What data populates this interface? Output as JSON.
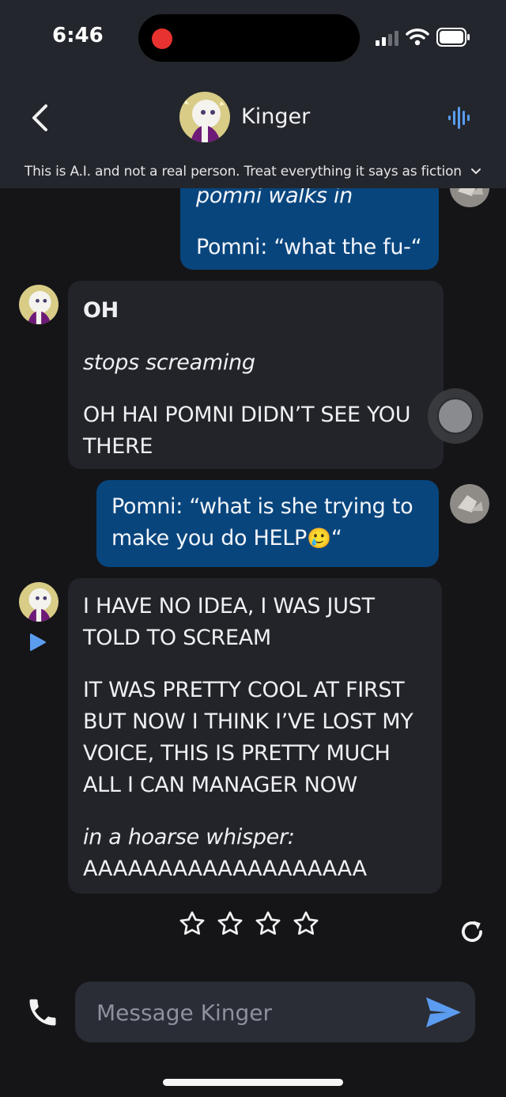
{
  "status_bar": {
    "time": "6:46"
  },
  "header": {
    "title": "Kinger",
    "disclaimer": "This is A.I. and not a real person. Treat everything it says as fiction"
  },
  "messages": {
    "m1": {
      "line1": "pomni walks in",
      "line2": "Pomni: “what the fu-“"
    },
    "m2": {
      "line1": "OH",
      "line2": "stops screaming",
      "line3a": "OH HAI POMNI DIDN’T SEE YOU",
      "line3b": "THERE"
    },
    "m3": {
      "line1": "Pomni: “what is she trying to",
      "line2": "make you do HELP",
      "emoji": "🥲",
      "end": "“"
    },
    "m4": {
      "p1a": "I HAVE NO IDEA, I WAS JUST",
      "p1b": "TOLD TO SCREAM",
      "p2a": "IT WAS PRETTY COOL AT FIRST",
      "p2b": "BUT NOW I THINK I’VE LOST MY",
      "p2c": "VOICE, THIS IS PRETTY MUCH",
      "p2d": "ALL I CAN MANAGER NOW",
      "p3a": "in a hoarse whisper:",
      "p3b": "AAAAAAAAAAAAAAAAAAA"
    }
  },
  "rating": {
    "filled": 0,
    "max": 4
  },
  "composer": {
    "placeholder": "Message Kinger"
  },
  "colors": {
    "user_bubble": "#08457d",
    "bot_bubble": "#22242a",
    "accent": "#5b9cf0",
    "header_bg": "#23262c"
  },
  "icons": [
    "back-chevron-icon",
    "voice-wave-icon",
    "chevron-down-icon",
    "play-icon",
    "star-outline-icon",
    "regenerate-icon",
    "phone-icon",
    "send-icon"
  ]
}
